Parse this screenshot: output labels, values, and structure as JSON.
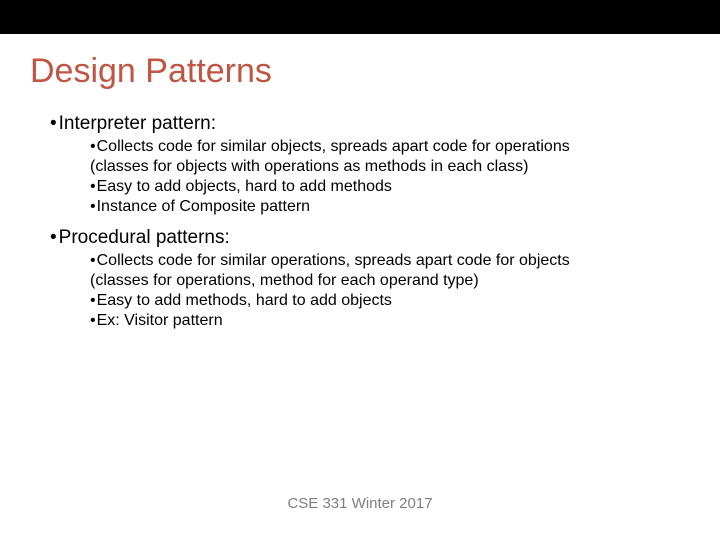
{
  "title": "Design Patterns",
  "topics": [
    {
      "heading": "Interpreter pattern:",
      "items": [
        {
          "first": "Collects code for similar objects, spreads apart code for operations",
          "cont": "(classes for objects with operations as methods in each class)"
        },
        {
          "first": "Easy to add objects, hard to add methods"
        },
        {
          "first": "Instance of Composite pattern"
        }
      ]
    },
    {
      "heading": "Procedural patterns:",
      "items": [
        {
          "first": "Collects code for similar operations, spreads apart code for objects",
          "cont": "(classes for operations, method for each operand type)"
        },
        {
          "first": "Easy to add methods, hard to add objects"
        },
        {
          "first": "Ex: Visitor pattern"
        }
      ]
    }
  ],
  "footer": "CSE 331 Winter 2017"
}
